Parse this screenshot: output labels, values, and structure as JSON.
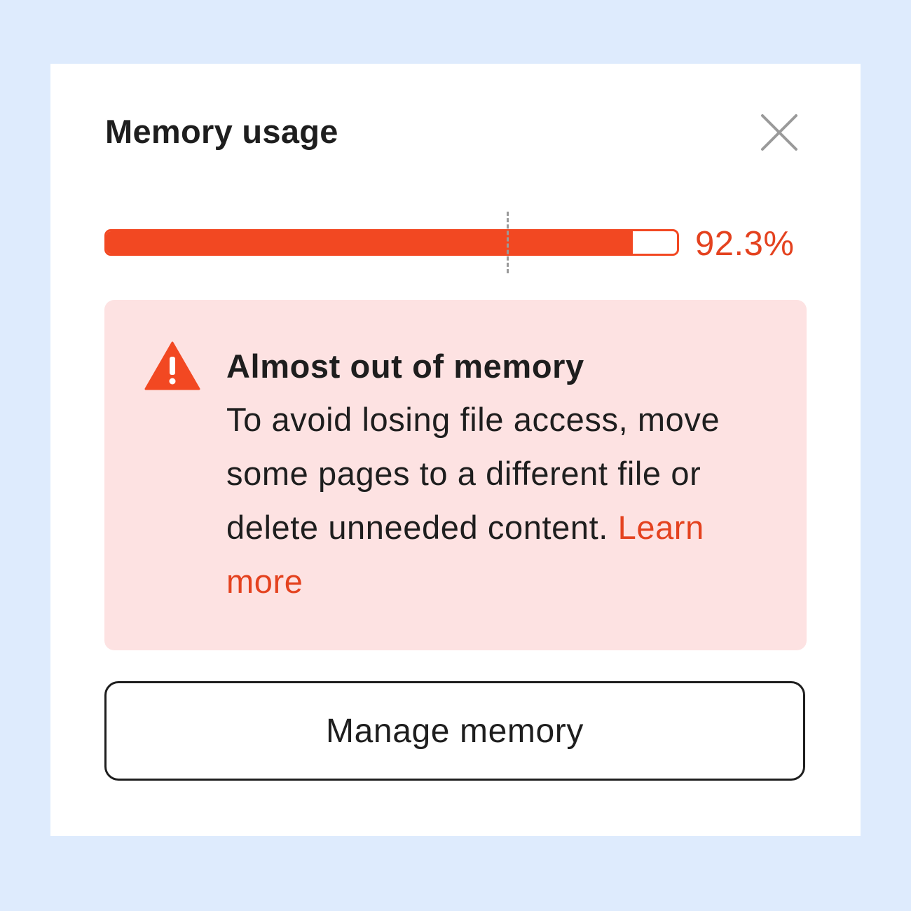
{
  "panel": {
    "title": "Memory usage",
    "close_icon": "close-icon"
  },
  "usage": {
    "fraction": 0.923,
    "percent_label": "92.3%",
    "threshold_fraction": 0.7,
    "bar_color": "#f24822"
  },
  "alert": {
    "icon": "warning-triangle-icon",
    "heading": "Almost out of memory",
    "body": "To avoid losing file access, move some pages to a different file or delete unneeded content.",
    "link_label": "Learn more",
    "background_color": "#fde2e2",
    "accent_color": "#e4421f"
  },
  "actions": {
    "manage_label": "Manage memory"
  }
}
